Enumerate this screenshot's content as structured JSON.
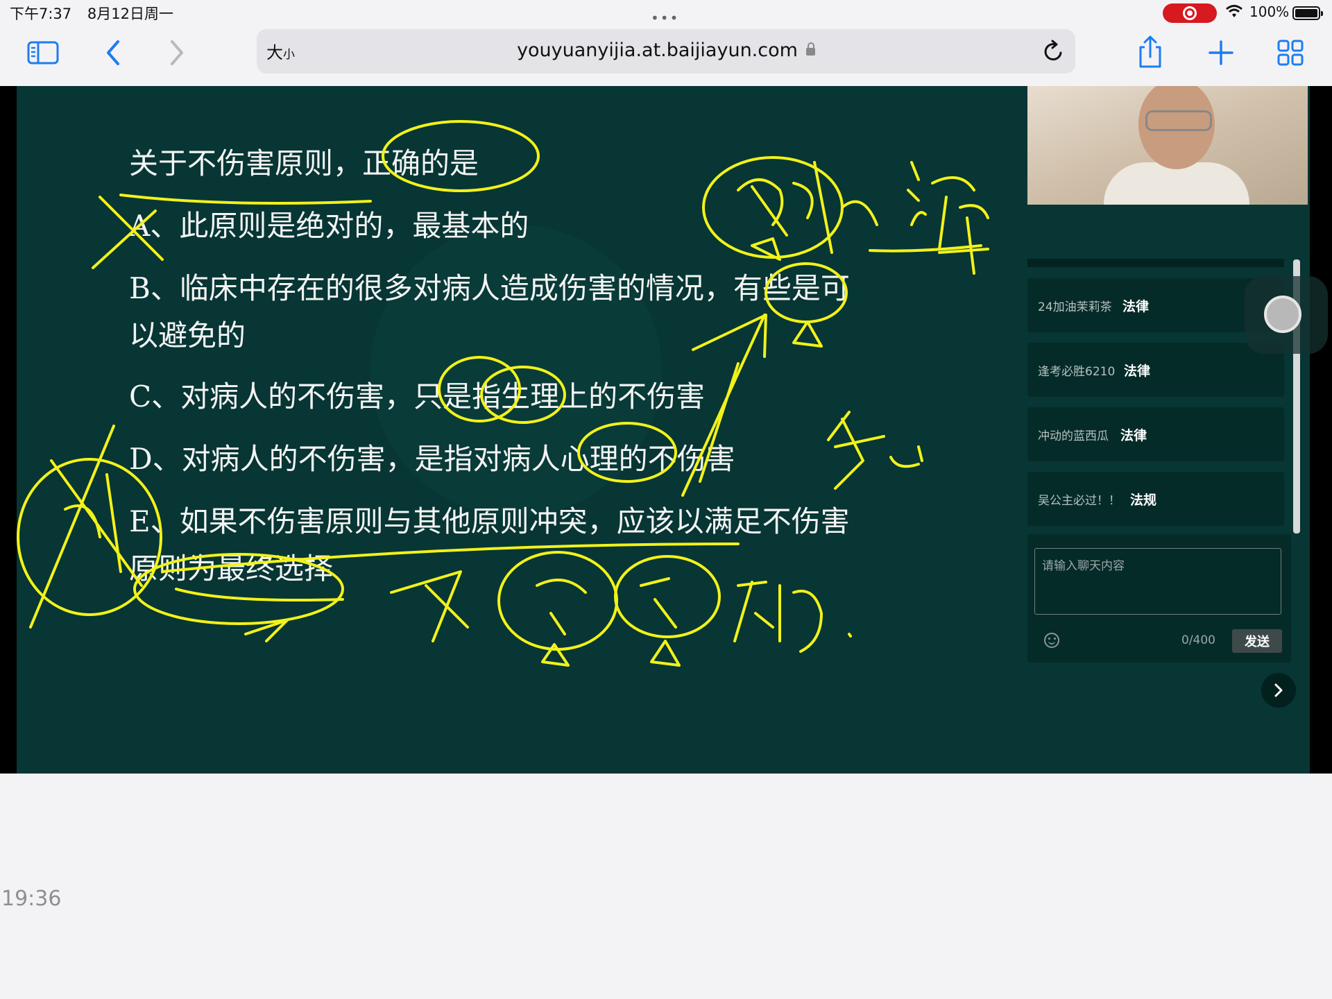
{
  "status_bar": {
    "time": "下午7:37",
    "date": "8月12日周一",
    "battery": "100%"
  },
  "toolbar": {
    "reader_big": "大",
    "reader_small": "小",
    "url": "youyuanyijia.at.baijiayun.com"
  },
  "question": {
    "title": "关于不伤害原则，正确的是",
    "option_a": "A、此原则是绝对的，最基本的",
    "option_b_line1": "B、临床中存在的很多对病人造成伤害的情况，有些是可",
    "option_b_line2": "以避免的",
    "option_c": "C、对病人的不伤害，只是指生理上的不伤害",
    "option_d": "D、对病人的不伤害，是指对病人心理的不伤害",
    "option_e_line1": "E、如果不伤害原则与其他原则冲突，应该以满足不伤害",
    "option_e_line2": "原则为最终选择"
  },
  "chat": {
    "messages": [
      {
        "user": "24加油茉莉茶",
        "text": "法律"
      },
      {
        "user": "逢考必胜6210",
        "text": "法律"
      },
      {
        "user": "冲动的蓝西瓜",
        "text": "法律"
      },
      {
        "user": "吴公主必过！！",
        "text": "法规"
      }
    ],
    "input_placeholder": "请输入聊天内容",
    "char_count": "0/400",
    "send_label": "发送"
  },
  "recording_timestamp": "19:36",
  "colors": {
    "board": "#073634",
    "ink": "#f2f21a",
    "record": "#d71920"
  }
}
